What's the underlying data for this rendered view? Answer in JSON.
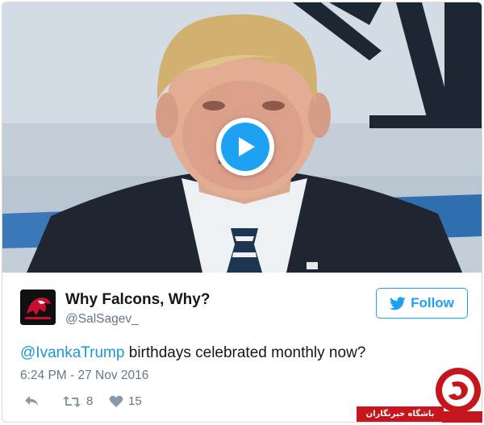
{
  "media": {
    "play_label": "Play video"
  },
  "author": {
    "name": "Why Falcons, Why?",
    "handle": "@SalSagev_"
  },
  "follow": {
    "label": "Follow"
  },
  "tweet": {
    "mention": "@IvankaTrump",
    "text": " birthdays celebrated monthly now?",
    "timestamp": "6:24 PM - 27 Nov 2016"
  },
  "actions": {
    "reply_icon": "reply-icon",
    "retweet_icon": "retweet-icon",
    "retweet_count": "8",
    "like_icon": "heart-icon",
    "like_count": "15"
  },
  "watermark": {
    "text": "باشگاه خبرنگاران"
  },
  "colors": {
    "accent": "#1da1f2",
    "mention": "#1b95e0",
    "muted": "#657786",
    "watermark_red": "#c4161c"
  }
}
